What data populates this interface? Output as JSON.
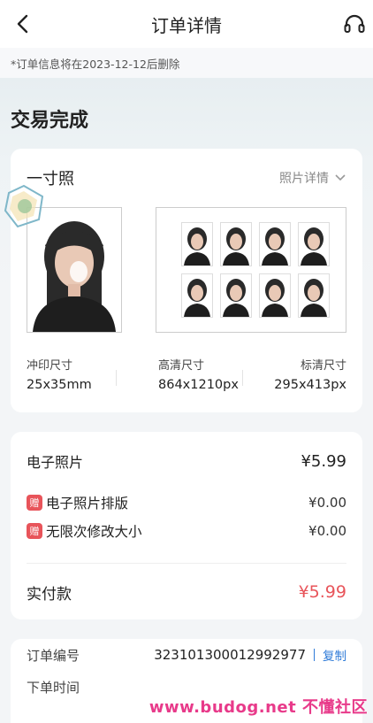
{
  "nav": {
    "title": "订单详情"
  },
  "notice": "*订单信息将在2023-12-12后删除",
  "status": "交易完成",
  "photo": {
    "type": "一寸照",
    "detail_label": "照片详情",
    "specs": [
      {
        "label": "冲印尺寸",
        "value": "25x35mm"
      },
      {
        "label": "高清尺寸",
        "value": "864x1210px"
      },
      {
        "label": "标清尺寸",
        "value": "295x413px"
      }
    ]
  },
  "price": {
    "item_label": "电子照片",
    "item_value": "¥5.99",
    "gift_badge": "赠",
    "gifts": [
      {
        "label": "电子照片排版",
        "value": "¥0.00"
      },
      {
        "label": "无限次修改大小",
        "value": "¥0.00"
      }
    ],
    "paid_label": "实付款",
    "paid_value": "¥5.99"
  },
  "order": {
    "number_label": "订单编号",
    "number_value": "323101300012992977",
    "copy_label": "复制",
    "time_label": "下单时间"
  },
  "watermark": "www.budog.net 不懂社区",
  "colors": {
    "accent_red": "#e8545a",
    "link_blue": "#2f7bd8"
  }
}
